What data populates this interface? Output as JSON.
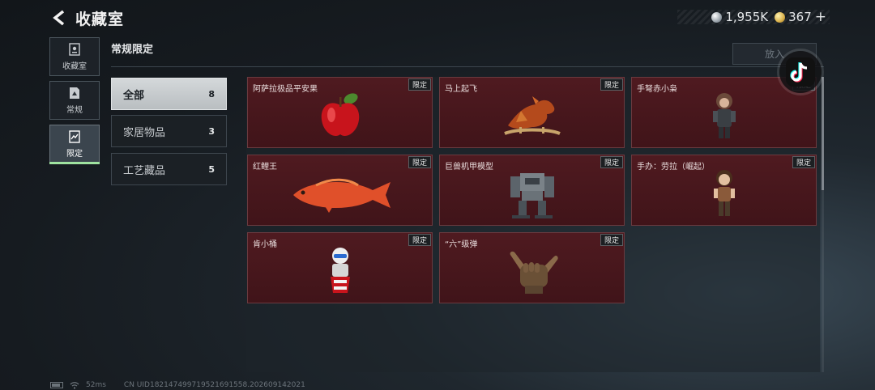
{
  "header": {
    "title": "收藏室",
    "currency": [
      {
        "icon": "silver-coin-icon",
        "value": "1,955K"
      },
      {
        "icon": "gold-coin-icon",
        "value": "367"
      }
    ],
    "add_symbol": "+"
  },
  "rail": {
    "items": [
      {
        "label": "收藏室",
        "icon": "collection-room-icon",
        "active": false
      },
      {
        "label": "常规",
        "icon": "regular-icon",
        "active": false
      },
      {
        "label": "限定",
        "icon": "limited-icon",
        "active": true
      }
    ]
  },
  "section": {
    "title": "常规限定",
    "put_button": "放入"
  },
  "categories": [
    {
      "name": "全部",
      "count": "8",
      "active": true
    },
    {
      "name": "家居物品",
      "count": "3",
      "active": false
    },
    {
      "name": "工艺藏品",
      "count": "5",
      "active": false
    }
  ],
  "items": [
    {
      "name": "阿萨拉极品平安果",
      "tag": "限定",
      "art": "apple-art"
    },
    {
      "name": "马上起飞",
      "tag": "限定",
      "art": "flying-horse-art"
    },
    {
      "name": "手弩赤小枭",
      "tag": "限定",
      "art": "hooded-figure-art"
    },
    {
      "name": "红鲤王",
      "tag": "限定",
      "art": "red-carp-art"
    },
    {
      "name": "巨兽机甲模型",
      "tag": "限定",
      "art": "mech-model-art"
    },
    {
      "name": "手办：劳拉（崛起）",
      "tag": "限定",
      "art": "lara-figure-art"
    },
    {
      "name": "肯小桶",
      "tag": "限定",
      "art": "bucket-mascot-art"
    },
    {
      "name": "“六”级弹",
      "tag": "限定",
      "art": "shaka-hand-art"
    }
  ],
  "status": {
    "ping": "52ms",
    "uid": "CN UID18214749971952169155​8.202609142021"
  },
  "colors": {
    "card_bg": "#4a1820",
    "card_border": "#6a3a3f",
    "accent_green": "#9fe3a0"
  }
}
